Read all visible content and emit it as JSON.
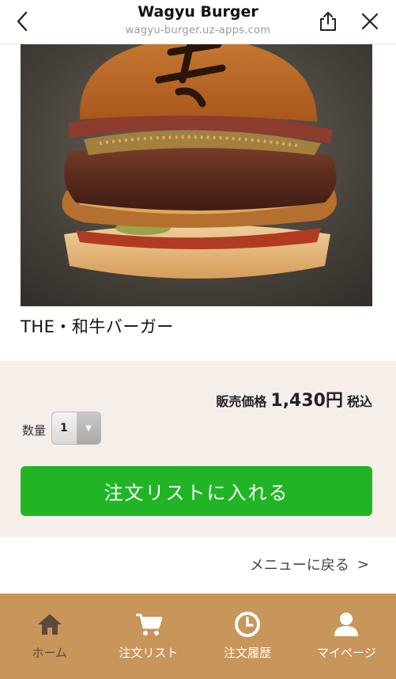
{
  "header": {
    "title": "Wagyu Burger",
    "url": "wagyu-burger.uz-apps.com",
    "back_icon": "chevron-left-icon",
    "share_icon": "share-icon",
    "close_icon": "close-icon"
  },
  "product": {
    "name": "THE・和牛バーガー",
    "price_label": "販売価格",
    "price": "1,430円",
    "tax_label": "税込",
    "quantity_label": "数量",
    "quantity_value": "1",
    "order_button": "注文リストに入れる"
  },
  "back_link": {
    "label": "メニューに戻る",
    "arrow": ">"
  },
  "nav": {
    "items": [
      {
        "label": "ホーム",
        "icon": "home-icon"
      },
      {
        "label": "注文リスト",
        "icon": "cart-icon"
      },
      {
        "label": "注文履歴",
        "icon": "clock-icon"
      },
      {
        "label": "マイページ",
        "icon": "user-icon"
      }
    ]
  },
  "colors": {
    "accent_green": "#21b526",
    "nav_bg": "#c8955b",
    "panel_bg": "#f6efe9"
  }
}
